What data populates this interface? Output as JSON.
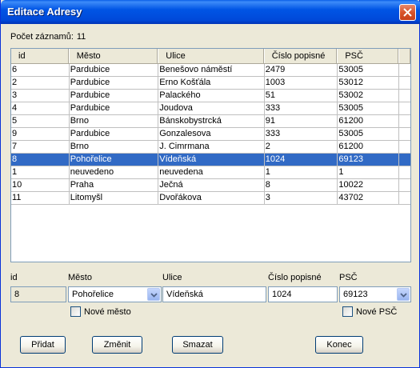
{
  "window": {
    "title": "Editace Adresy"
  },
  "record_count": {
    "label": "Počet záznamů:",
    "value": "11"
  },
  "table": {
    "columns": [
      "id",
      "Město",
      "Ulice",
      "Číslo popisné",
      "PSČ"
    ],
    "rows": [
      {
        "id": "6",
        "mesto": "Pardubice",
        "ulice": "Benešovo náměstí",
        "cislo": "2479",
        "psc": "53005"
      },
      {
        "id": "2",
        "mesto": "Pardubice",
        "ulice": "Erno Košťála",
        "cislo": "1003",
        "psc": "53012"
      },
      {
        "id": "3",
        "mesto": "Pardubice",
        "ulice": "Palackého",
        "cislo": "51",
        "psc": "53002"
      },
      {
        "id": "4",
        "mesto": "Pardubice",
        "ulice": "Joudova",
        "cislo": "333",
        "psc": "53005"
      },
      {
        "id": "5",
        "mesto": "Brno",
        "ulice": "Bánskobystrcká",
        "cislo": "91",
        "psc": "61200"
      },
      {
        "id": "9",
        "mesto": "Pardubice",
        "ulice": "Gonzalesova",
        "cislo": "333",
        "psc": "53005"
      },
      {
        "id": "7",
        "mesto": "Brno",
        "ulice": "J. Cimrmana",
        "cislo": "2",
        "psc": "61200"
      },
      {
        "id": "8",
        "mesto": "Pohořelice",
        "ulice": "Vídeňská",
        "cislo": "1024",
        "psc": "69123"
      },
      {
        "id": "1",
        "mesto": "neuvedeno",
        "ulice": "neuvedena",
        "cislo": "1",
        "psc": "1"
      },
      {
        "id": "10",
        "mesto": "Praha",
        "ulice": "Ječná",
        "cislo": "8",
        "psc": "10022"
      },
      {
        "id": "11",
        "mesto": "Litomyšl",
        "ulice": "Dvořákova",
        "cislo": "3",
        "psc": "43702"
      }
    ],
    "selected_row": 7
  },
  "form": {
    "labels": {
      "id": "id",
      "mesto": "Město",
      "ulice": "Ulice",
      "cislo": "Číslo popisné",
      "psc": "PSČ"
    },
    "values": {
      "id": "8",
      "mesto": "Pohořelice",
      "ulice": "Vídeňská",
      "cislo": "1024",
      "psc": "69123"
    },
    "new_city_label": "Nové město",
    "new_psc_label": "Nové PSČ"
  },
  "buttons": {
    "add": "Přidat",
    "change": "Změnit",
    "delete": "Smazat",
    "close": "Konec"
  },
  "colors": {
    "title_bar": "#0055E5",
    "selection": "#316AC5",
    "window_bg": "#ECE9D8"
  }
}
